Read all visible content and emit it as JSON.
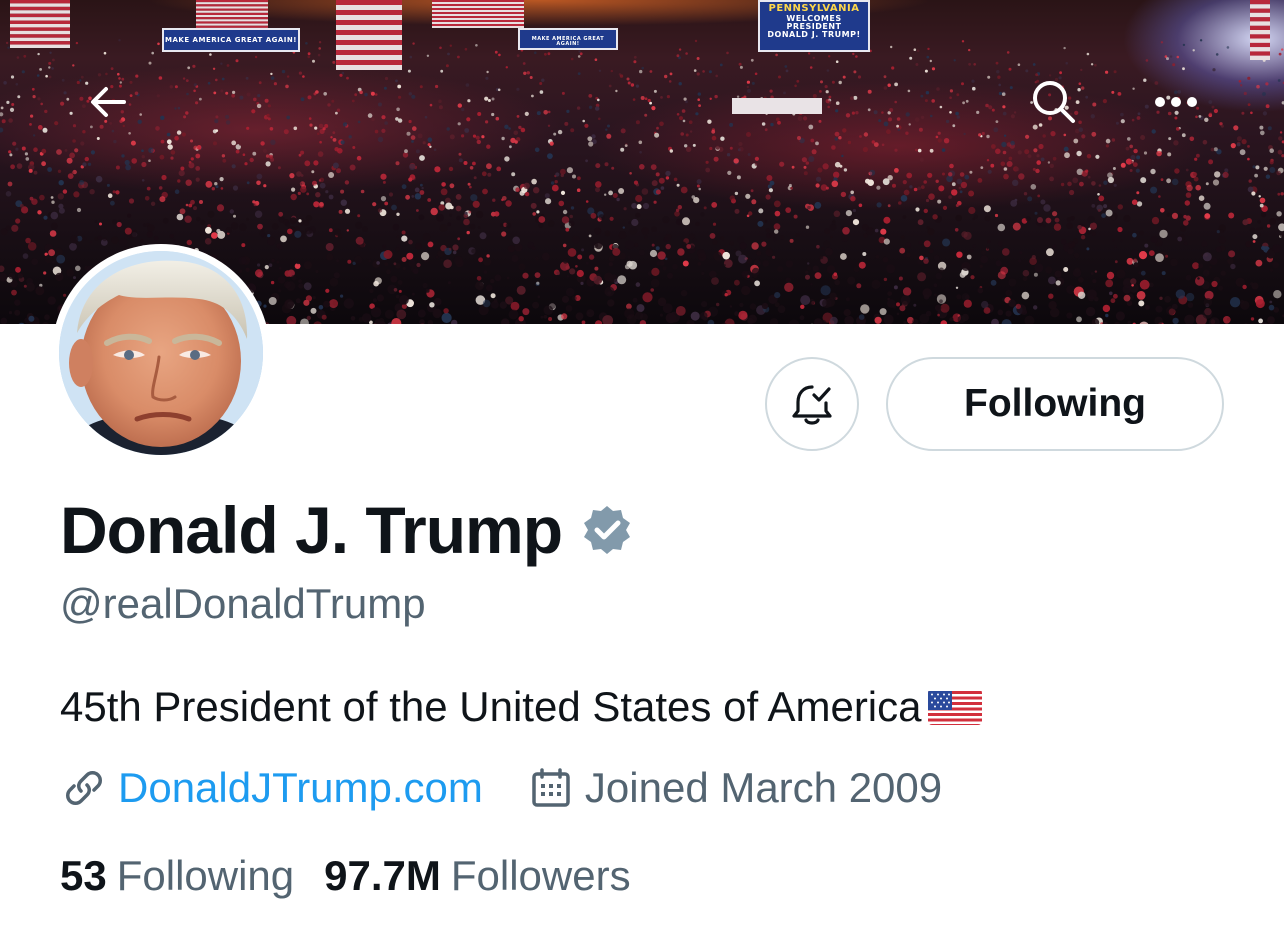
{
  "banner": {
    "signs": {
      "left": "MAKE AMERICA GREAT AGAIN!",
      "mid": "MAKE AMERICA GREAT AGAIN!",
      "top_line1": "PENNSYLVANIA",
      "top_line2": "WELCOMES",
      "top_line3": "PRESIDENT",
      "top_line4": "DONALD J. TRUMP!"
    },
    "icons": {
      "back": "arrow-left-icon",
      "search": "search-icon",
      "more": "more-horizontal-icon"
    }
  },
  "profile": {
    "display_name": "Donald J. Trump",
    "verified": true,
    "handle": "@realDonaldTrump",
    "bio": "45th President of the United States of America",
    "bio_emoji": "us-flag",
    "website": "DonaldJTrump.com",
    "joined": "Joined March 2009"
  },
  "actions": {
    "notify_icon": "bell-check-icon",
    "following_label": "Following"
  },
  "stats": {
    "following_count": "53",
    "following_label": "Following",
    "followers_count": "97.7M",
    "followers_label": "Followers"
  },
  "colors": {
    "text_primary": "#0f1419",
    "text_secondary": "#536471",
    "link": "#1d9bf0",
    "verified_badge": "#829aab",
    "border": "#cfd9de"
  }
}
